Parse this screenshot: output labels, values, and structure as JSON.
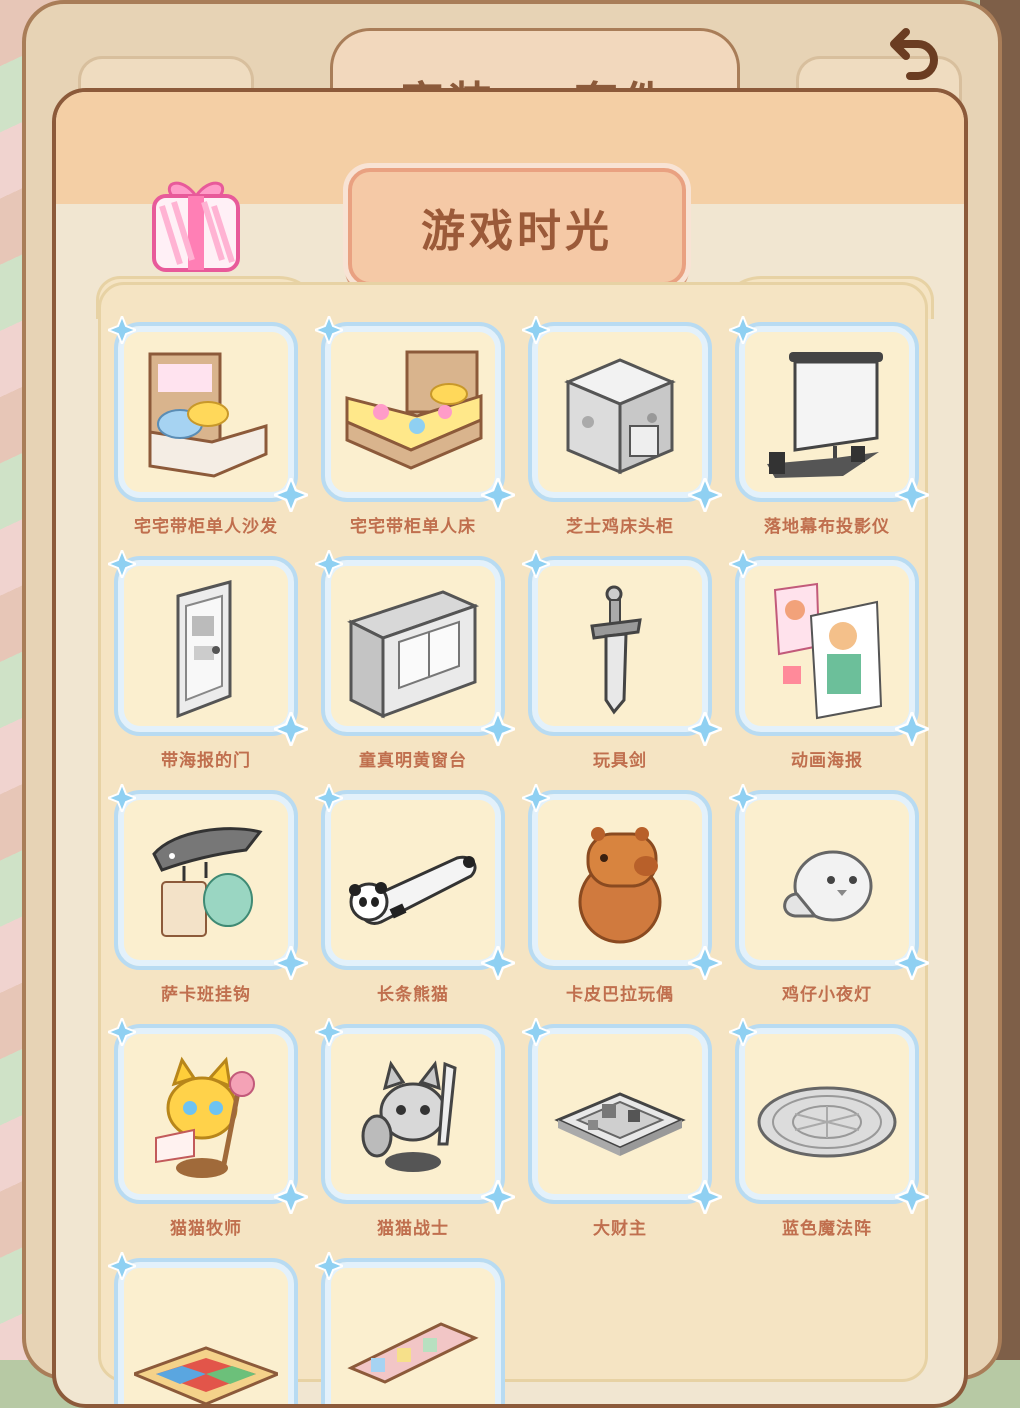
{
  "header": {
    "outer_tab_1": "家装",
    "outer_tab_2": "套件",
    "title": "游戏时光"
  },
  "items": [
    {
      "label": "宅宅带柜单人沙发",
      "icon": "sofa-bed-icon"
    },
    {
      "label": "宅宅带柜单人床",
      "icon": "single-bed-icon"
    },
    {
      "label": "芝士鸡床头柜",
      "icon": "cheese-nightstand-icon"
    },
    {
      "label": "落地幕布投影仪",
      "icon": "projector-screen-icon"
    },
    {
      "label": "带海报的门",
      "icon": "poster-door-icon"
    },
    {
      "label": "童真明黄窗台",
      "icon": "window-seat-icon"
    },
    {
      "label": "玩具剑",
      "icon": "toy-sword-icon"
    },
    {
      "label": "动画海报",
      "icon": "anime-poster-icon"
    },
    {
      "label": "萨卡班挂钩",
      "icon": "shark-hook-icon"
    },
    {
      "label": "长条熊猫",
      "icon": "long-panda-icon"
    },
    {
      "label": "卡皮巴拉玩偶",
      "icon": "capybara-plush-icon"
    },
    {
      "label": "鸡仔小夜灯",
      "icon": "chick-nightlight-icon"
    },
    {
      "label": "猫猫牧师",
      "icon": "cat-priest-icon"
    },
    {
      "label": "猫猫战士",
      "icon": "cat-warrior-icon"
    },
    {
      "label": "大财主",
      "icon": "board-game-icon"
    },
    {
      "label": "蓝色魔法阵",
      "icon": "magic-circle-rug-icon"
    },
    {
      "label": "",
      "icon": "colorful-table-icon"
    },
    {
      "label": "",
      "icon": "tile-wall-icon"
    }
  ],
  "colors": {
    "card_border": "#b8dbf2",
    "card_fill": "#fbefcf",
    "label_text": "#c06f4e",
    "title_text": "#9b5a39"
  }
}
